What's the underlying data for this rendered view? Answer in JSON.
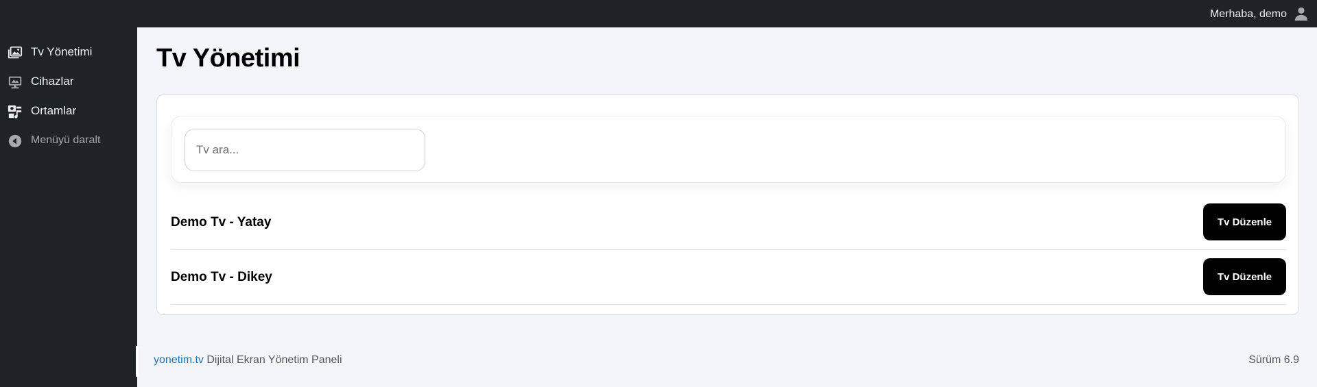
{
  "topbar": {
    "greeting": "Merhaba, demo",
    "user_icon": "user-icon"
  },
  "sidebar": {
    "items": [
      {
        "label": "Tv Yönetimi",
        "icon": "tv-gallery-icon"
      },
      {
        "label": "Cihazlar",
        "icon": "monitor-icon"
      },
      {
        "label": "Ortamlar",
        "icon": "media-icon"
      },
      {
        "label": "Menüyü daralt",
        "icon": "collapse-arrow-icon"
      }
    ]
  },
  "main": {
    "title": "Tv Yönetimi",
    "search": {
      "placeholder": "Tv ara...",
      "value": ""
    },
    "tvs": [
      {
        "name": "Demo Tv - Yatay",
        "button": "Tv Düzenle"
      },
      {
        "name": "Demo Tv - Dikey",
        "button": "Tv Düzenle"
      }
    ]
  },
  "footer": {
    "brand": "yonetim.tv",
    "tagline": "Dijital Ekran Yönetim Paneli",
    "version": "Sürüm 6.9"
  },
  "colors": {
    "sidebar_bg": "#1d2327",
    "content_bg": "#f4f5f9",
    "link": "#2271b1",
    "button_bg": "#000000"
  }
}
